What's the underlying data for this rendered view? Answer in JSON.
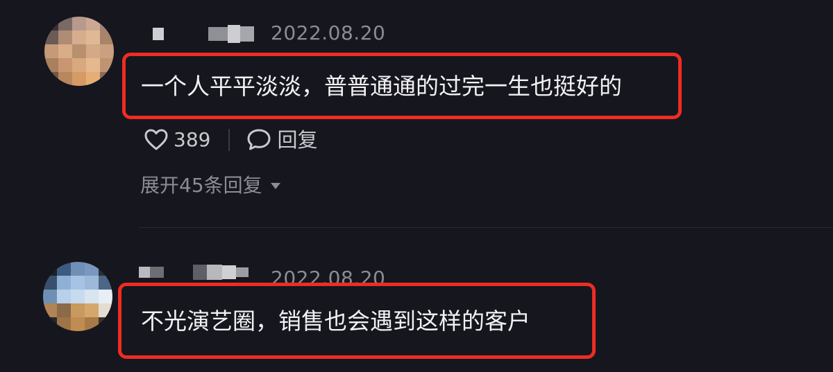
{
  "comments": [
    {
      "timestamp": "2022.08.20",
      "text": "一个人平平淡淡，普普通通的过完一生也挺好的",
      "likes": "389",
      "reply_label": "回复",
      "expand_label": "展开45条回复"
    },
    {
      "timestamp": "2022.08.20",
      "text": "不光演艺圈，销售也会遇到这样的客户"
    }
  ],
  "icons": {
    "like": "heart-icon",
    "reply": "speech-bubble-icon",
    "expand": "caret-down-icon"
  },
  "colors": {
    "background": "#16161e",
    "highlight_border": "#ee2c24",
    "secondary_text": "#8c8c94"
  }
}
